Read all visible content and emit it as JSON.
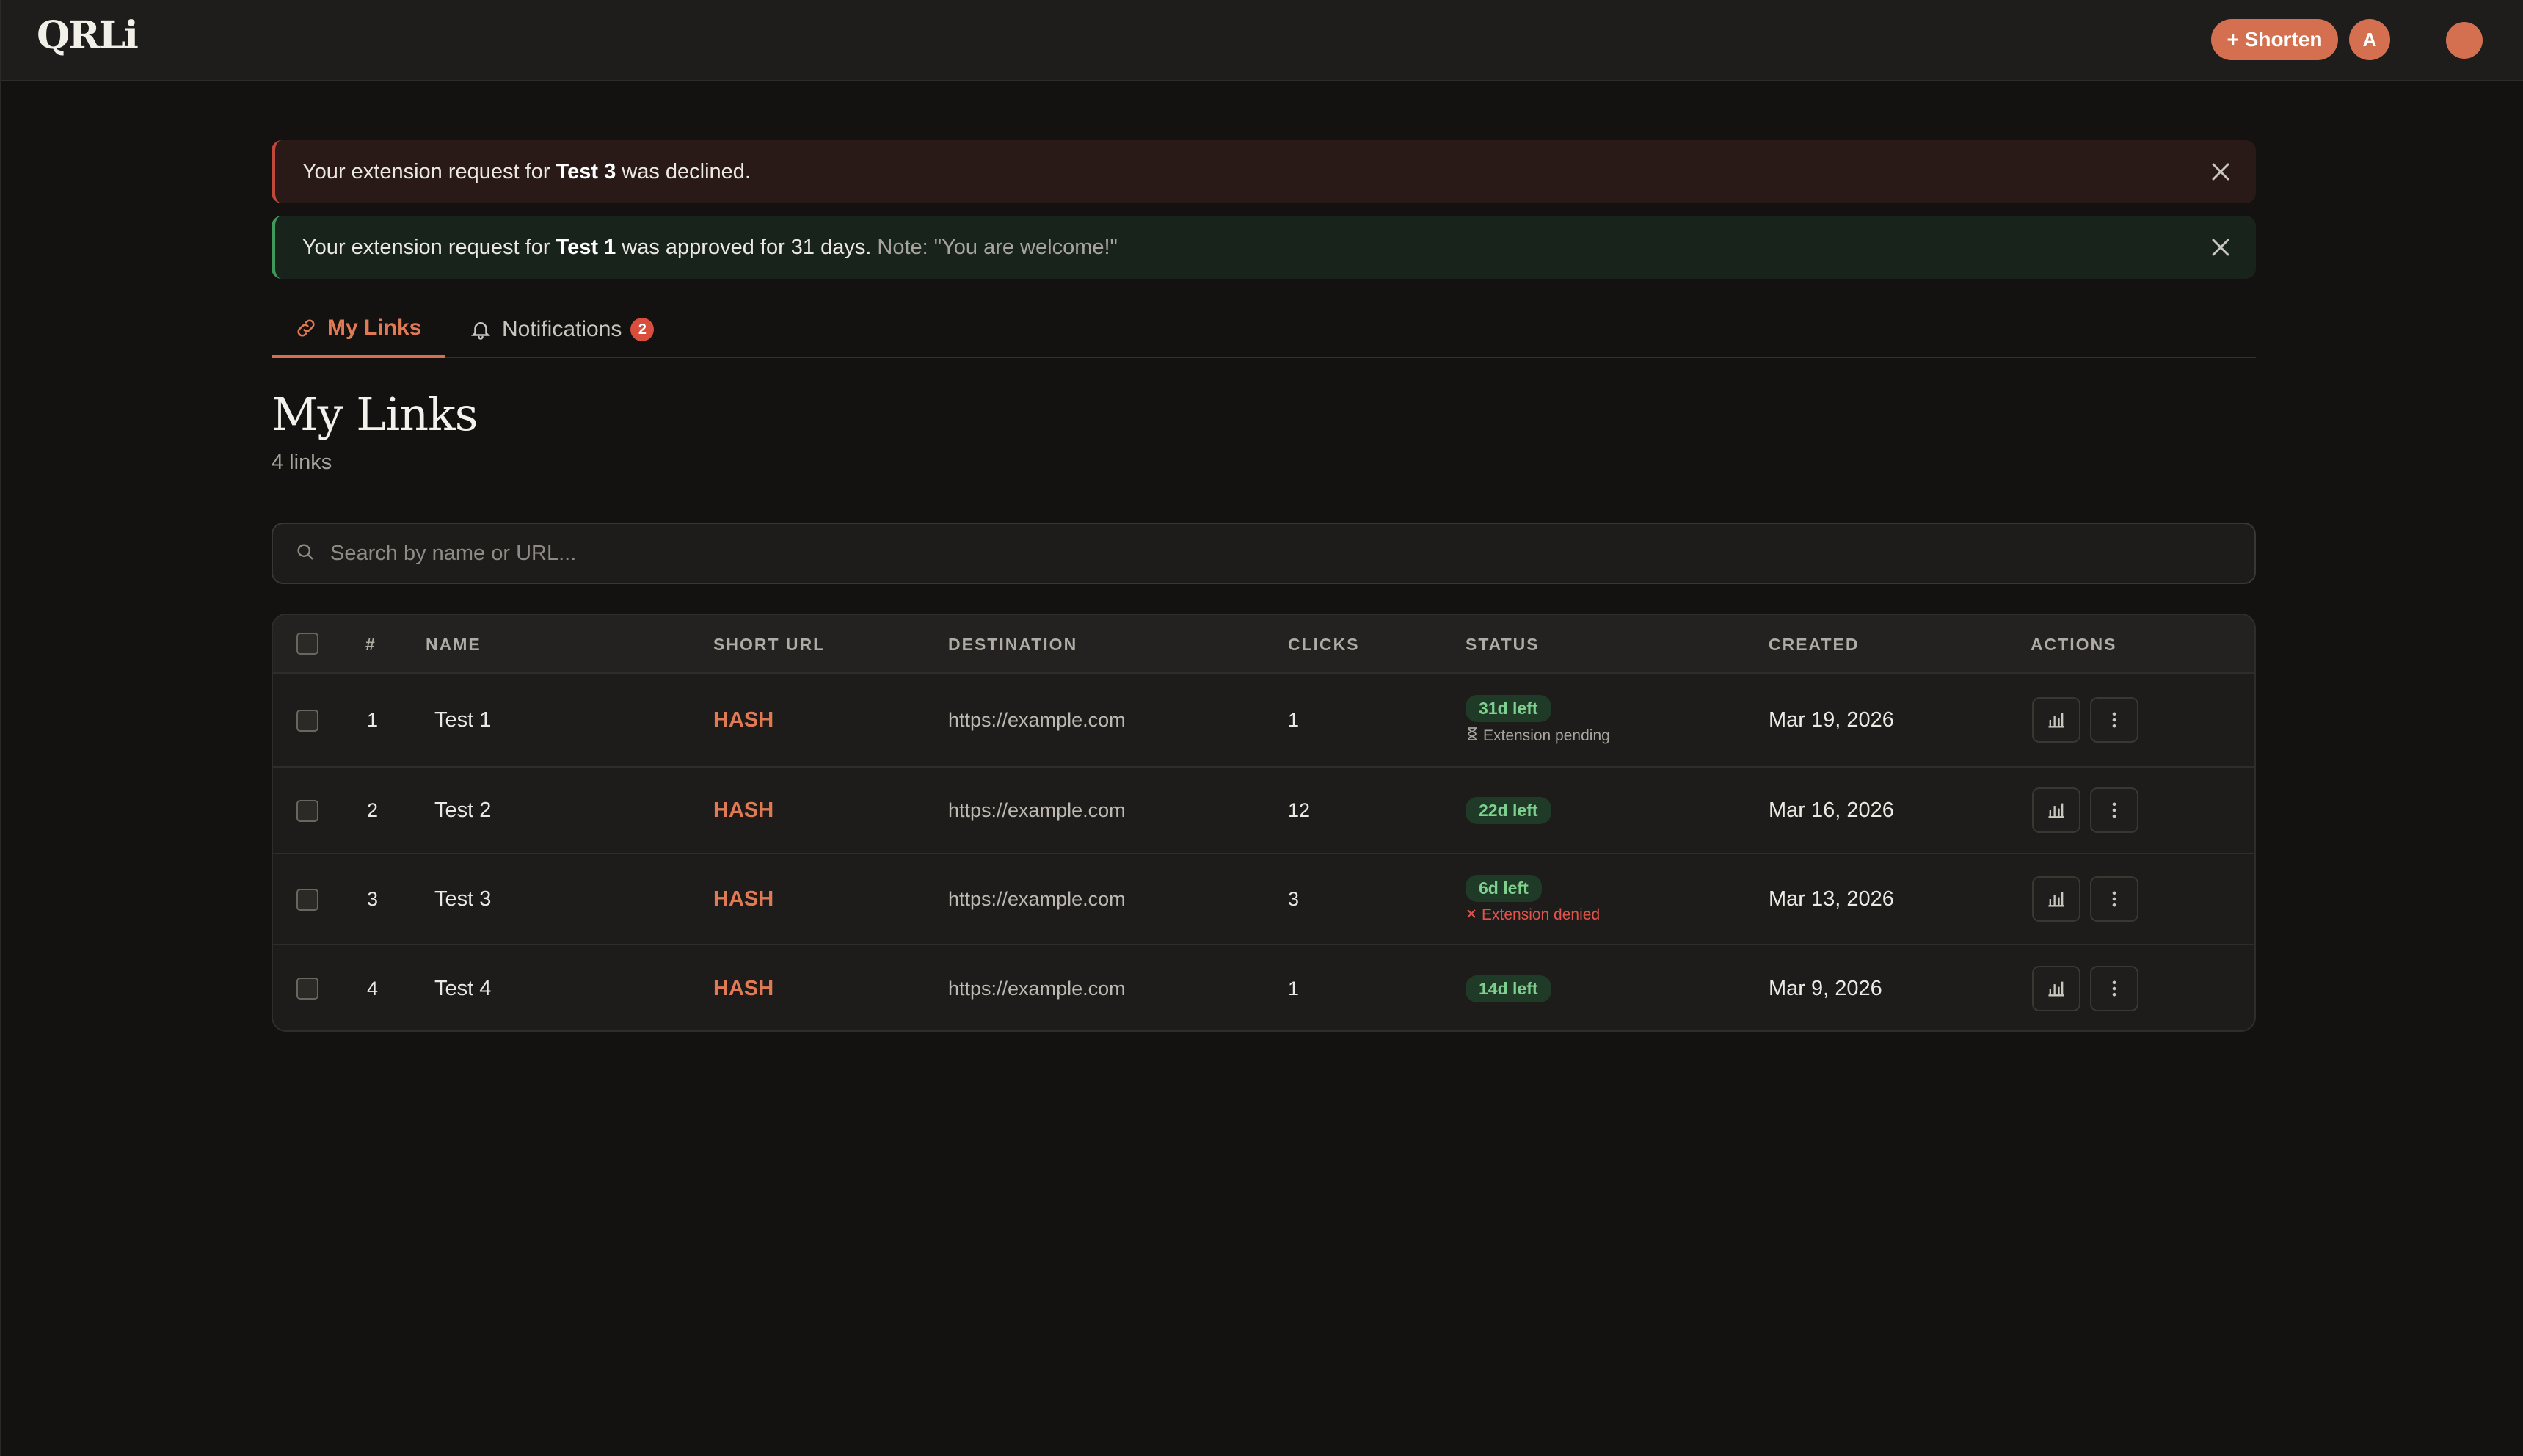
{
  "app": {
    "logo": "QRLi"
  },
  "topbar": {
    "shorten_label": "+ Shorten",
    "avatar_initial": "A"
  },
  "alerts": {
    "declined": {
      "prefix": "Your extension request for ",
      "link": "Test 3",
      "suffix": " was declined."
    },
    "approved": {
      "prefix": "Your extension request for ",
      "link": "Test 1",
      "suffix": " was approved for 31 days.",
      "note": "Note: \"You are welcome!\""
    }
  },
  "tabs": {
    "my_links": "My Links",
    "notifications": "Notifications",
    "notifications_count": "2"
  },
  "header": {
    "title": "My Links",
    "count": "4 links"
  },
  "search": {
    "placeholder": "Search by name or URL..."
  },
  "table": {
    "columns": [
      "#",
      "NAME",
      "SHORT URL",
      "DESTINATION",
      "CLICKS",
      "STATUS",
      "CREATED",
      "ACTIONS"
    ],
    "rows": [
      {
        "index": "1",
        "name": "Test 1",
        "short": "HASH",
        "dest": "https://example.com",
        "clicks": "1",
        "status": "31d left",
        "sub": "Extension pending",
        "sub_type": "pending",
        "created": "Mar 19, 2026"
      },
      {
        "index": "2",
        "name": "Test 2",
        "short": "HASH",
        "dest": "https://example.com",
        "clicks": "12",
        "status": "22d left",
        "sub": "",
        "sub_type": "",
        "created": "Mar 16, 2026"
      },
      {
        "index": "3",
        "name": "Test 3",
        "short": "HASH",
        "dest": "https://example.com",
        "clicks": "3",
        "status": "6d left",
        "sub": "Extension denied",
        "sub_type": "denied",
        "created": "Mar 13, 2026"
      },
      {
        "index": "4",
        "name": "Test 4",
        "short": "HASH",
        "dest": "https://example.com",
        "clicks": "1",
        "status": "14d left",
        "sub": "",
        "sub_type": "",
        "created": "Mar 9, 2026"
      }
    ]
  }
}
